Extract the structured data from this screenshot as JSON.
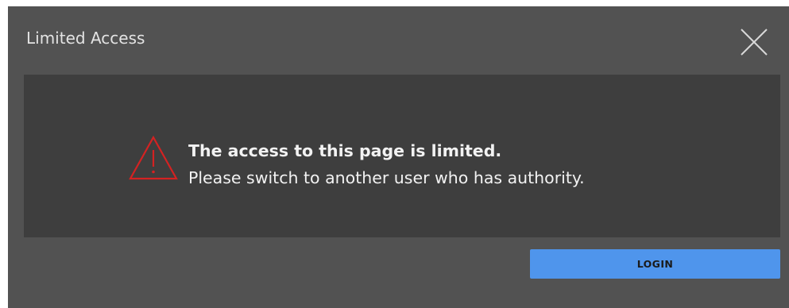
{
  "dialog": {
    "title": "Limited Access",
    "close_icon": "close-icon"
  },
  "message": {
    "icon": "warning-triangle-icon",
    "title": "The access to this page is limited.",
    "body": "Please switch to another user who has authority."
  },
  "actions": {
    "login_label": "LOGIN"
  },
  "colors": {
    "dialog_background": "#525252",
    "panel_background": "#3e3e3e",
    "warning_red": "#d42222",
    "login_button": "#4f95ec"
  }
}
